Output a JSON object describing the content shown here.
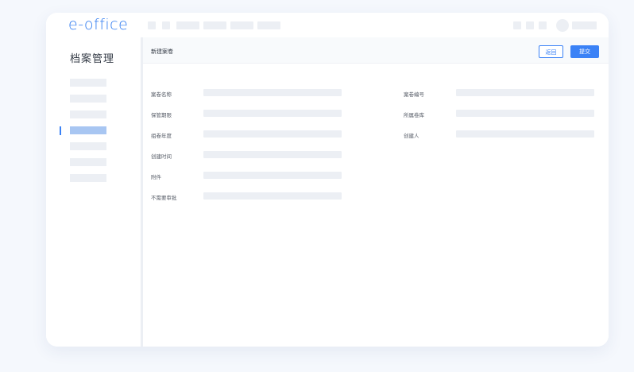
{
  "app": {
    "logo": "e-office"
  },
  "sidebar": {
    "module_title": "档案管理",
    "active_index": 3
  },
  "main": {
    "title": "新建案卷",
    "buttons": {
      "back": "返回",
      "submit": "提交"
    },
    "left_fields": [
      "案卷名称",
      "保管期限",
      "组卷年度",
      "创建时间",
      "附件",
      "不需要审批"
    ],
    "right_fields": [
      "案卷编号",
      "所属卷库",
      "创建人"
    ]
  },
  "colors": {
    "accent": "#3b82f6",
    "logo": "#2f7bf0",
    "active_nav": "#a8c6f2",
    "placeholder": "#eceff4"
  }
}
